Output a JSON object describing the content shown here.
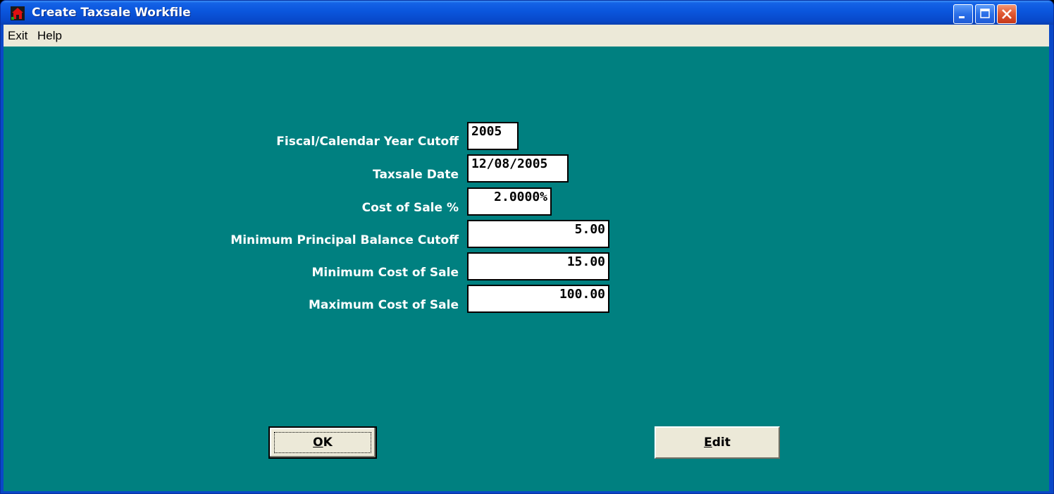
{
  "window": {
    "title": "Create Taxsale Workfile"
  },
  "menu": {
    "exit": "Exit",
    "help": "Help"
  },
  "form": {
    "fiscal_year_cutoff": {
      "label": "Fiscal/Calendar Year Cutoff",
      "value": "2005"
    },
    "taxsale_date": {
      "label": "Taxsale Date",
      "value": "12/08/2005"
    },
    "cost_of_sale_pct": {
      "label": "Cost of Sale %",
      "value": "2.0000%"
    },
    "min_principal_balance_cutoff": {
      "label": "Minimum Principal Balance Cutoff",
      "value": "5.00"
    },
    "min_cost_of_sale": {
      "label": "Minimum Cost of Sale",
      "value": "15.00"
    },
    "max_cost_of_sale": {
      "label": "Maximum Cost of Sale",
      "value": "100.00"
    }
  },
  "buttons": {
    "ok": {
      "mnemonic": "O",
      "rest": "K"
    },
    "edit": {
      "mnemonic": "E",
      "rest": "dit"
    }
  },
  "icons": {
    "app": "red-house-icon",
    "minimize": "minimize-icon",
    "maximize": "maximize-icon",
    "close": "close-icon"
  },
  "colors": {
    "background": "#008080",
    "titlebar": "#0a55dc",
    "menubar": "#ece9d8",
    "close_button": "#e25a33"
  }
}
